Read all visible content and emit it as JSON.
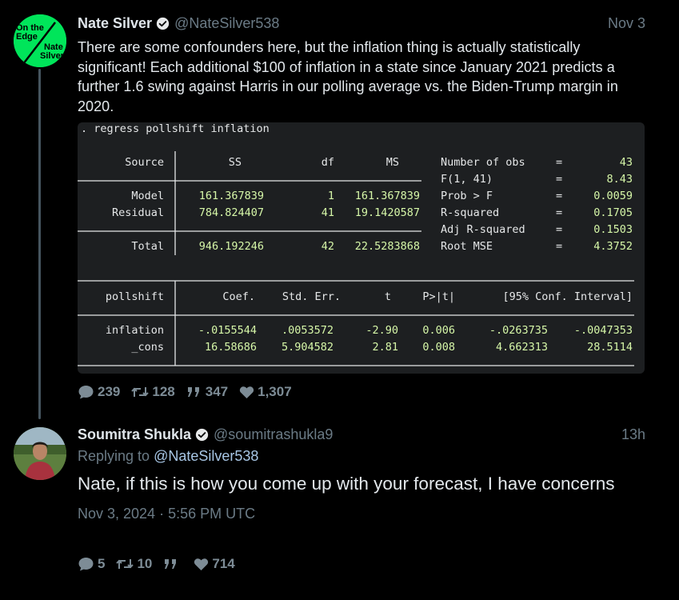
{
  "tweet1": {
    "name": "Nate Silver",
    "handle": "@NateSilver538",
    "time": "Nov 3",
    "avatar_text": [
      "On the",
      "Edge",
      "Nate",
      "Silver"
    ],
    "text": "There are some confounders here, but the inflation thing is actually statistically significant! Each additional $100 of inflation in a state since January 2021 predicts a further 1.6 swing against Harris in our polling average vs. the Biden-Trump margin in 2020.",
    "console": {
      "command": ". regress pollshift inflation",
      "anova_headers": [
        "Source",
        "SS",
        "df",
        "MS"
      ],
      "anova_rows": [
        {
          "source": "Model",
          "ss": "161.367839",
          "df": "1",
          "ms": "161.367839"
        },
        {
          "source": "Residual",
          "ss": "784.824407",
          "df": "41",
          "ms": "19.1420587"
        },
        {
          "source": "Total",
          "ss": "946.192246",
          "df": "42",
          "ms": "22.5283868"
        }
      ],
      "stats": [
        {
          "label": "Number of obs",
          "eq": "=",
          "value": "43"
        },
        {
          "label": "F(1, 41)",
          "eq": "=",
          "value": "8.43"
        },
        {
          "label": "Prob > F",
          "eq": "=",
          "value": "0.0059"
        },
        {
          "label": "R-squared",
          "eq": "=",
          "value": "0.1705"
        },
        {
          "label": "Adj R-squared",
          "eq": "=",
          "value": "0.1503"
        },
        {
          "label": "Root MSE",
          "eq": "=",
          "value": "4.3752"
        }
      ],
      "coef_headers": [
        "pollshift",
        "Coef.",
        "Std. Err.",
        "t",
        "P>|t|",
        "[95% Conf. Interval]"
      ],
      "coef_rows": [
        {
          "var": "inflation",
          "coef": "-.0155544",
          "se": ".0053572",
          "t": "-2.90",
          "p": "0.006",
          "lo": "-.0263735",
          "hi": "-.0047353"
        },
        {
          "var": "_cons",
          "coef": "16.58686",
          "se": "5.904582",
          "t": "2.81",
          "p": "0.008",
          "lo": "4.662313",
          "hi": "28.5114"
        }
      ]
    },
    "replies": "239",
    "retweets": "128",
    "quotes": "347",
    "likes": "1,307"
  },
  "tweet2": {
    "name": "Soumitra Shukla",
    "handle": "@soumitrashukla9",
    "time": "13h",
    "replying_prefix": "Replying to",
    "replying_handle": "@NateSilver538",
    "text": "Nate, if this is how you come up with your forecast, I have concerns",
    "timestamp": "Nov 3, 2024 · 5:56 PM UTC",
    "replies": "5",
    "retweets": "10",
    "quotes": "",
    "likes": "714"
  },
  "colors": {
    "background": "#000000",
    "link": "#a8c7e6",
    "muted": "#6b7b86",
    "console_bg": "#1d1f21",
    "console_value": "#d6f7a8",
    "avatar_green": "#00e55a"
  }
}
